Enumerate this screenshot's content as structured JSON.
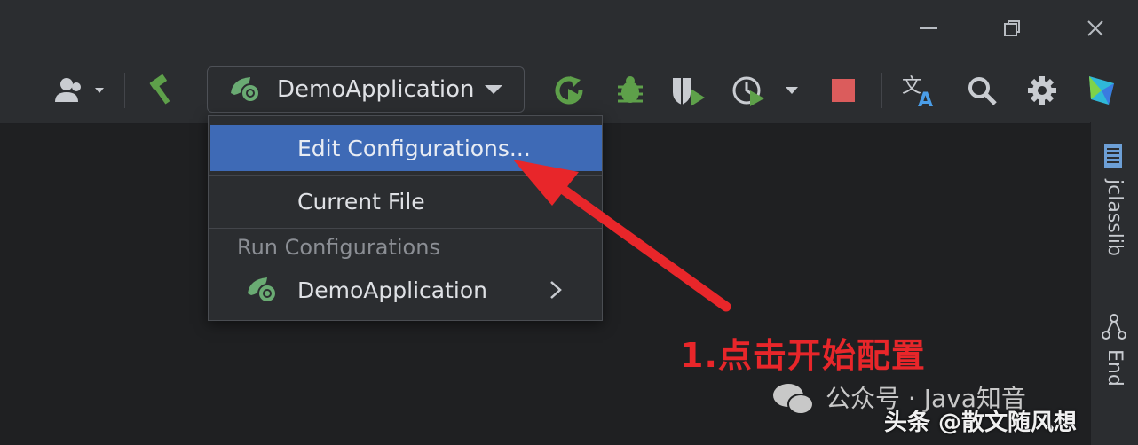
{
  "toolbar": {
    "run_config": "DemoApplication"
  },
  "dropdown": {
    "edit_configurations": "Edit Configurations...",
    "current_file": "Current File",
    "section_run_configurations": "Run Configurations",
    "demo_application": "DemoApplication"
  },
  "right_sidebar": {
    "jclasslib": "jclasslib",
    "endpoints": "End"
  },
  "annotation": {
    "text": "1.点击开始配置"
  },
  "watermark": {
    "wechat": "公众号 · Java知音",
    "toutiao": "头条 @散文随风想"
  },
  "colors": {
    "selection": "#3e6ab6",
    "arrow": "#e8262a",
    "spring_green": "#6aab73",
    "stop_red": "#db5c5c"
  }
}
